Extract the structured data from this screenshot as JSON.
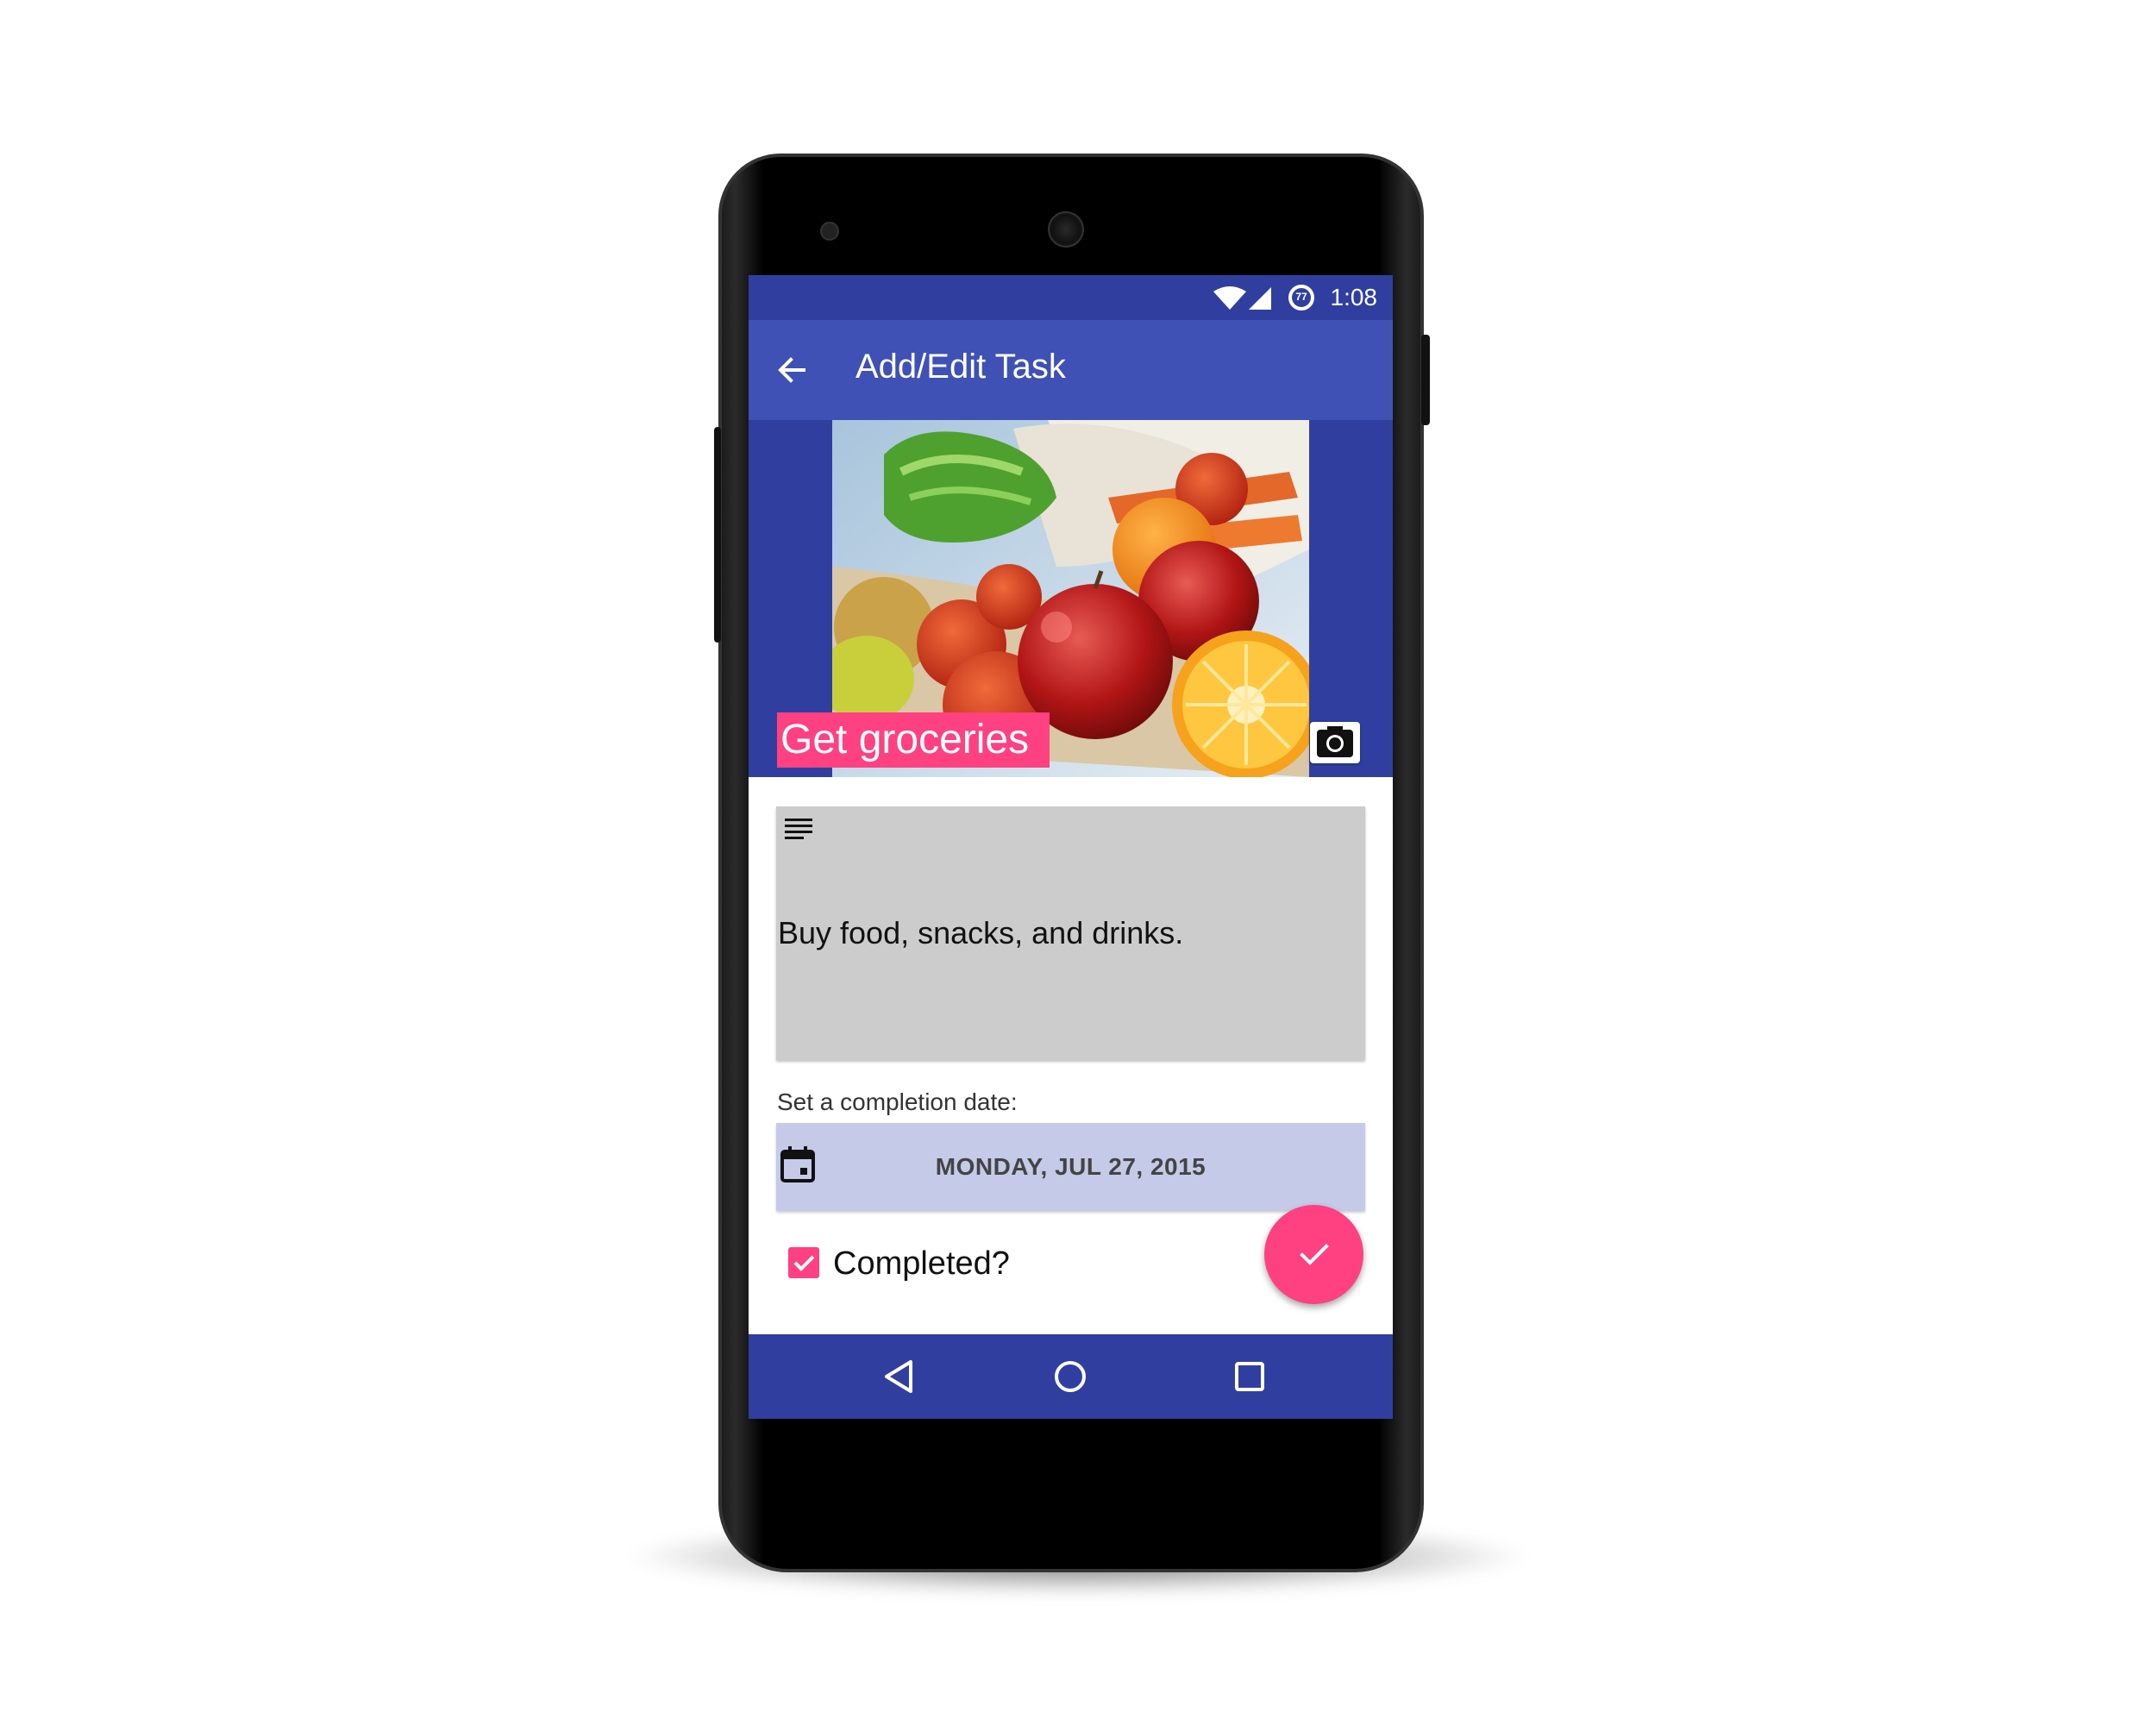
{
  "status_bar": {
    "time": "1:08",
    "battery_level": "77",
    "icons": [
      "wifi-icon",
      "signal-icon",
      "battery-icon"
    ]
  },
  "app_bar": {
    "title": "Add/Edit Task",
    "back_icon": "arrow-back-icon"
  },
  "task": {
    "name": "Get groceries",
    "image": "groceries-photo",
    "camera_icon": "camera-icon",
    "description": "Buy food, snacks, and drinks.",
    "description_icon": "notes-icon"
  },
  "completion": {
    "label": "Set a completion date:",
    "date": "MONDAY, JUL 27, 2015",
    "date_icon": "calendar-icon",
    "completed_label": "Completed?",
    "completed": true
  },
  "fab": {
    "icon": "check-icon"
  },
  "nav_bar": {
    "icons": [
      "nav-back-icon",
      "nav-home-icon",
      "nav-recents-icon"
    ]
  },
  "colors": {
    "primary": "#3f51b5",
    "primary_dark": "#303f9f",
    "accent": "#ff4081",
    "date_bg": "#c5cae9",
    "desc_bg": "#cccccc"
  }
}
